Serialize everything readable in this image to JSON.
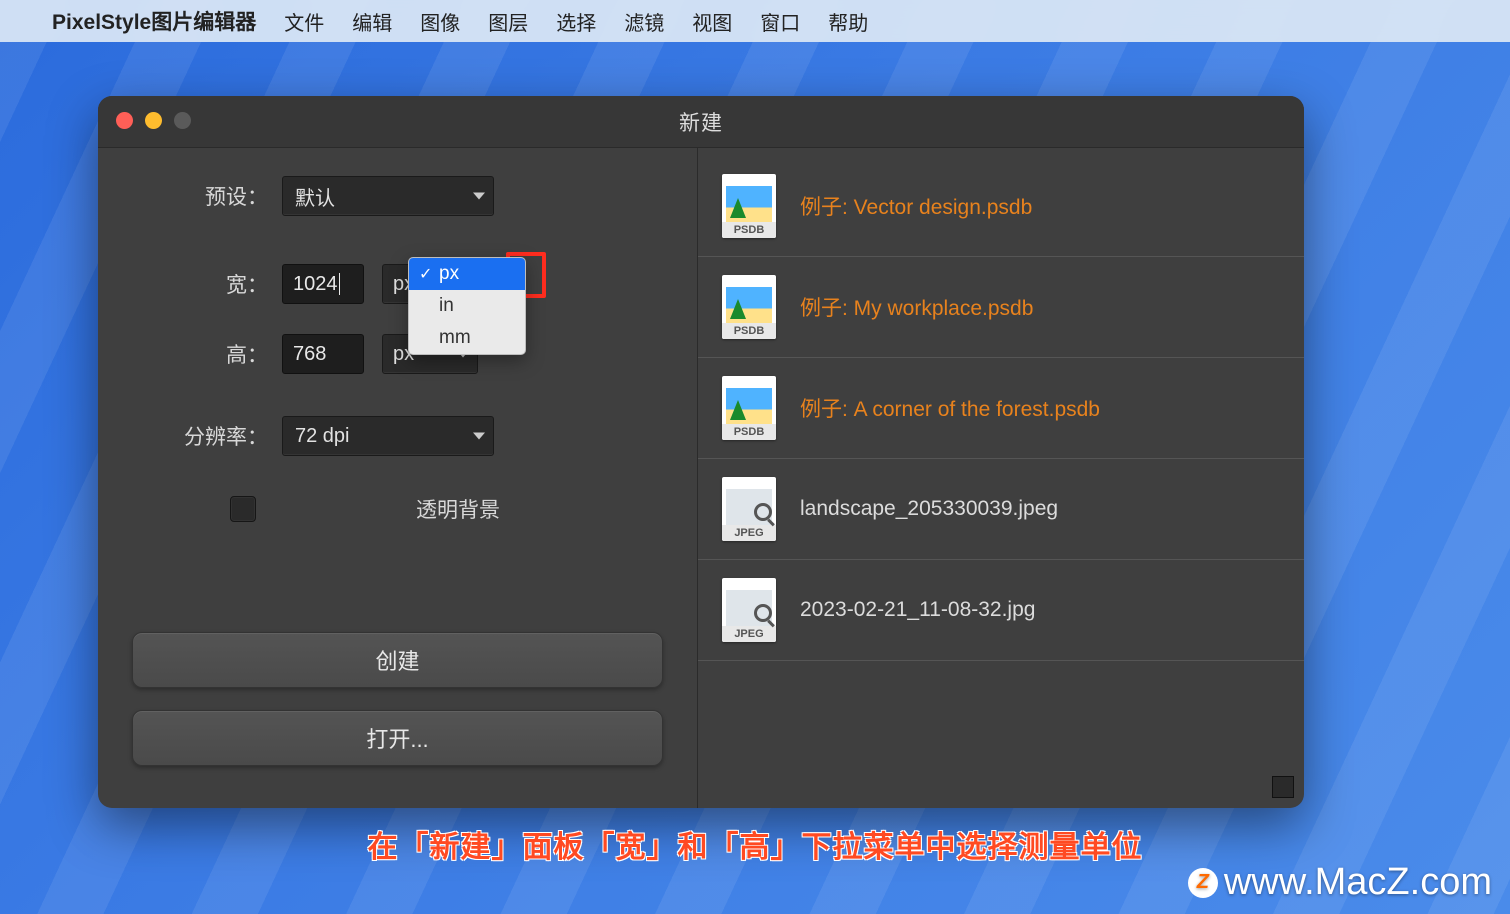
{
  "menubar": {
    "appname": "PixelStyle图片编辑器",
    "items": [
      "文件",
      "编辑",
      "图像",
      "图层",
      "选择",
      "滤镜",
      "视图",
      "窗口",
      "帮助"
    ]
  },
  "dialog": {
    "title": "新建",
    "preset_label": "预设：",
    "preset_value": "默认",
    "width_label": "宽：",
    "width_value": "1024",
    "height_label": "高：",
    "height_value": "768",
    "height_unit": "px",
    "resolution_label": "分辨率：",
    "resolution_value": "72 dpi",
    "transparent_label": "透明背景",
    "create_button": "创建",
    "open_button": "打开...",
    "unit_options": [
      "px",
      "in",
      "mm"
    ],
    "unit_selected": "px"
  },
  "recent": [
    {
      "type": "PSDB",
      "name": "例子: Vector design.psdb",
      "accent": true
    },
    {
      "type": "PSDB",
      "name": "例子: My workplace.psdb",
      "accent": true
    },
    {
      "type": "PSDB",
      "name": "例子: A corner of the forest.psdb",
      "accent": true
    },
    {
      "type": "JPEG",
      "name": "landscape_205330039.jpeg",
      "accent": false
    },
    {
      "type": "JPEG",
      "name": "2023-02-21_11-08-32.jpg",
      "accent": false
    }
  ],
  "caption": "在「新建」面板「宽」和「高」下拉菜单中选择测量单位",
  "watermark": "www.MacZ.com"
}
